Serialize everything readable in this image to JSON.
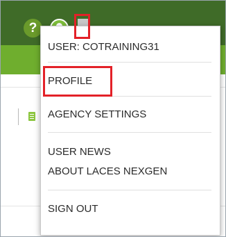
{
  "header": {
    "help_icon": "help-icon",
    "help_glyph": "?",
    "user_icon": "user-avatar-icon",
    "dropdown_icon": "caret-down-icon",
    "highlight_color": "#e32128",
    "bar_color": "#3f6b28",
    "subbar_color": "#6fae2e"
  },
  "user_menu": {
    "user_label": "USER: COTRAINING31",
    "items": [
      {
        "label": "PROFILE"
      },
      {
        "label": "AGENCY SETTINGS"
      },
      {
        "label": "USER NEWS"
      },
      {
        "label": "ABOUT LACES NEXGEN"
      },
      {
        "label": "SIGN OUT"
      }
    ]
  }
}
